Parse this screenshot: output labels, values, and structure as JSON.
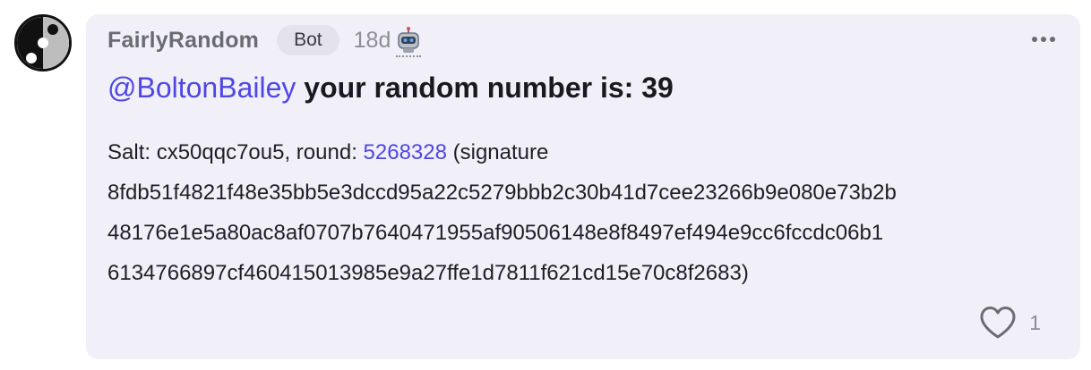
{
  "comment": {
    "username": "FairlyRandom",
    "badge": "Bot",
    "time": "18d",
    "mention": "@BoltonBailey",
    "title_rest": " your random number is: 39",
    "body": {
      "line1_prefix": "Salt: cx50qqc7ou5, round: ",
      "round_link": "5268328",
      "line1_suffix": " (signature",
      "line2": "8fdb51f4821f48e35bb5e3dccd95a22c5279bbb2c30b41d7cee23266b9e080e73b2b",
      "line3": "48176e1e5a80ac8af0707b7640471955af90506148e8f8497ef494e9cc6fccdc06b1",
      "line4": "6134766897cf460415013985e9a27ffe1d7811f621cd15e70c8f2683)"
    },
    "like_count": "1"
  },
  "icons": {
    "avatar": "dice-avatar-icon",
    "robot": "robot-icon",
    "menu": "more-horizontal-icon",
    "like": "heart-icon"
  },
  "colors": {
    "card_background": "#f1f0f8",
    "link": "#4f46e5",
    "muted_text": "#8d8d96"
  }
}
